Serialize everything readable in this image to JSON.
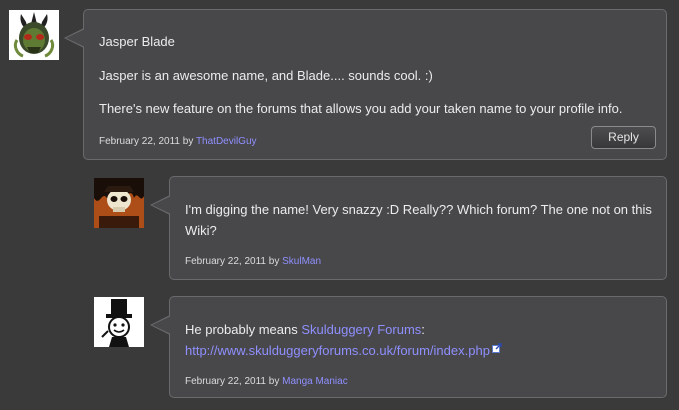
{
  "comments": [
    {
      "title": "Jasper Blade",
      "paragraphs": [
        "Jasper is an awesome name, and Blade.... sounds cool. :)",
        "There's new feature on the forums that allows you add your taken name to your profile info."
      ],
      "date": "February 22, 2011",
      "by_label": "by",
      "author": "ThatDevilGuy",
      "reply_label": "Reply",
      "avatar_icon": "demon-skull-avatar"
    },
    {
      "paragraphs": [
        "I'm digging the name! Very snazzy :D Really?? Which forum? The one not on this Wiki?"
      ],
      "date": "February 22, 2011",
      "by_label": "by",
      "author": "SkulMan",
      "avatar_icon": "skull-fire-avatar"
    },
    {
      "text_before_link": "He probably means ",
      "link_text": "Skulduggery Forums",
      "text_after_link": ":",
      "url_text": "http://www.skulduggeryforums.co.uk/forum/index.php",
      "date": "February 22, 2011",
      "by_label": "by",
      "author": "Manga Maniac",
      "avatar_icon": "top-hat-cartoon-avatar"
    }
  ],
  "colors": {
    "background": "#3a3a3a",
    "bubble": "#48484b",
    "bubble_border": "#6a6a6d",
    "link": "#8f8fff"
  }
}
